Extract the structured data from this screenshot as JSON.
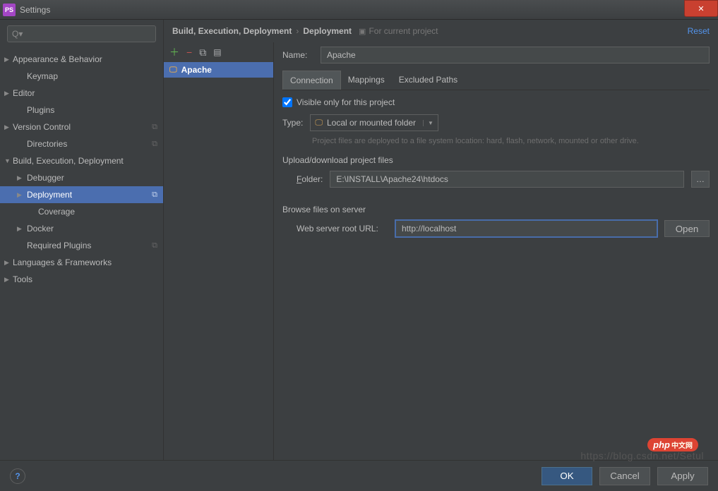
{
  "window": {
    "title": "Settings",
    "app_icon_text": "PS"
  },
  "search": {
    "placeholder": "Q▾"
  },
  "tree": [
    {
      "label": "Appearance & Behavior",
      "arrow": "▶",
      "indent": 0
    },
    {
      "label": "Keymap",
      "indent": 1
    },
    {
      "label": "Editor",
      "arrow": "▶",
      "indent": 0
    },
    {
      "label": "Plugins",
      "indent": 1
    },
    {
      "label": "Version Control",
      "arrow": "▶",
      "indent": 0,
      "badge": true
    },
    {
      "label": "Directories",
      "indent": 1,
      "badge": true
    },
    {
      "label": "Build, Execution, Deployment",
      "arrow": "▼",
      "indent": 0
    },
    {
      "label": "Debugger",
      "arrow": "▶",
      "indent": 1
    },
    {
      "label": "Deployment",
      "arrow": "▶",
      "indent": 1,
      "selected": true,
      "badge": true
    },
    {
      "label": "Coverage",
      "indent": 2
    },
    {
      "label": "Docker",
      "arrow": "▶",
      "indent": 1
    },
    {
      "label": "Required Plugins",
      "indent": 1,
      "badge": true
    },
    {
      "label": "Languages & Frameworks",
      "arrow": "▶",
      "indent": 0
    },
    {
      "label": "Tools",
      "arrow": "▶",
      "indent": 0
    }
  ],
  "breadcrumb": {
    "a": "Build, Execution, Deployment",
    "b": "Deployment"
  },
  "current_project_label": "For current project",
  "reset_label": "Reset",
  "server_list": {
    "selected": "Apache"
  },
  "form": {
    "name_label": "Name:",
    "name_value": "Apache",
    "tabs": [
      "Connection",
      "Mappings",
      "Excluded Paths"
    ],
    "active_tab": "Connection",
    "visible_only_label": "Visible only for this project",
    "visible_only_checked": true,
    "type_label": "Type:",
    "type_value": "Local or mounted folder",
    "type_hint": "Project files are deployed to a file system location: hard, flash, network, mounted or other drive.",
    "upload_section": "Upload/download project files",
    "folder_label": "Folder:",
    "folder_value": "E:\\INSTALL\\Apache24\\htdocs",
    "browse_section": "Browse files on server",
    "url_label": "Web server root URL:",
    "url_value": "http://localhost",
    "open_label": "Open"
  },
  "buttons": {
    "ok": "OK",
    "cancel": "Cancel",
    "apply": "Apply"
  },
  "watermark": "https://blog.csdn.net/Setul",
  "php_badge": "php"
}
